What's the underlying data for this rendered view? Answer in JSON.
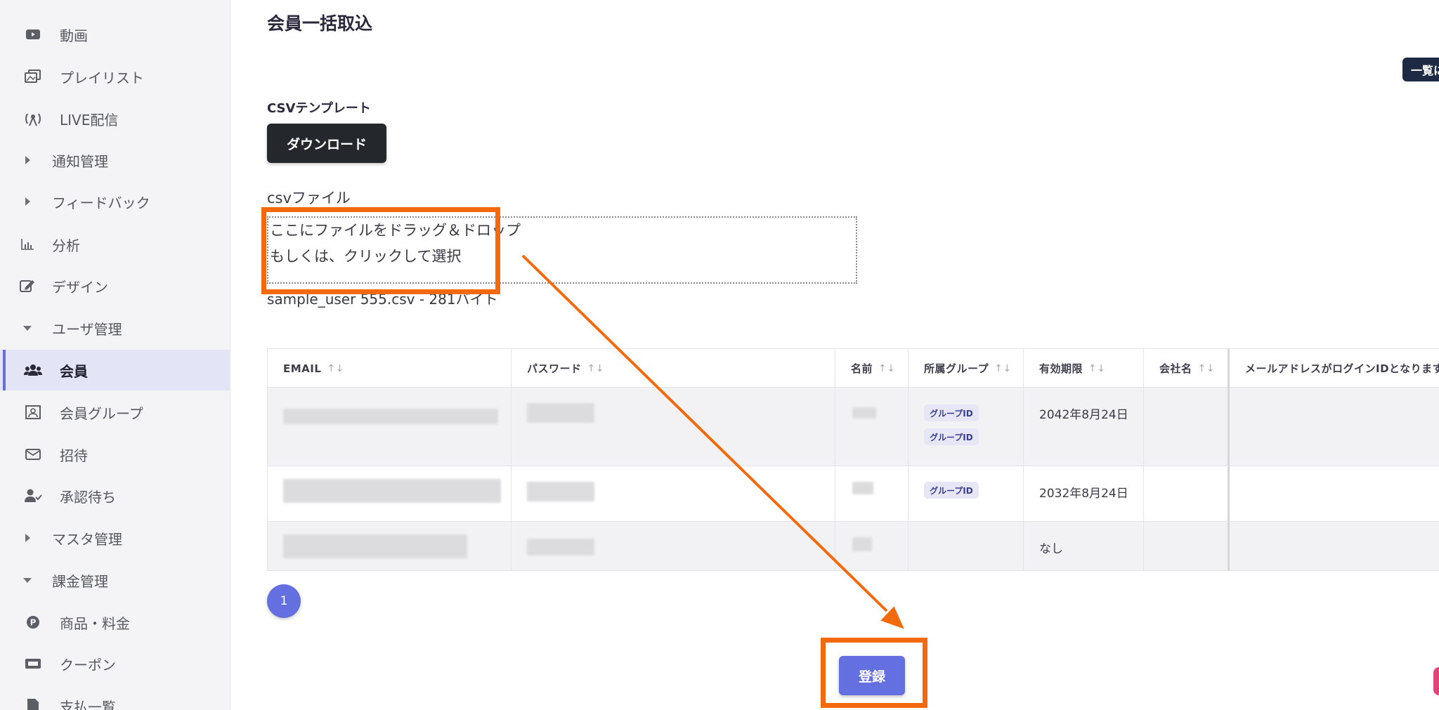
{
  "sidebar": {
    "items": [
      {
        "label": "動画",
        "icon": "video-icon"
      },
      {
        "label": "プレイリスト",
        "icon": "playlist-icon"
      },
      {
        "label": "LIVE配信",
        "icon": "live-broadcast-icon"
      },
      {
        "label": "通知管理",
        "icon": "expand-right-icon"
      },
      {
        "label": "フィードバック",
        "icon": "expand-right-icon"
      },
      {
        "label": "分析",
        "icon": "chart-icon"
      },
      {
        "label": "デザイン",
        "icon": "edit-icon"
      },
      {
        "label": "ユーザ管理",
        "icon": "collapse-down-icon"
      },
      {
        "label": "会員",
        "icon": "users-icon",
        "active": true
      },
      {
        "label": "会員グループ",
        "icon": "group-icon"
      },
      {
        "label": "招待",
        "icon": "mail-icon"
      },
      {
        "label": "承認待ち",
        "icon": "user-check-icon"
      },
      {
        "label": "マスタ管理",
        "icon": "expand-right-icon"
      },
      {
        "label": "課金管理",
        "icon": "collapse-down-icon"
      },
      {
        "label": "商品・料金",
        "icon": "p-coin-icon"
      },
      {
        "label": "クーポン",
        "icon": "ticket-icon"
      },
      {
        "label": "支払一覧",
        "icon": "document-icon"
      }
    ]
  },
  "main": {
    "title": "会員一括取込",
    "list_button": "一覧に",
    "csv_template_label": "CSVテンプレート",
    "download_button": "ダウンロード",
    "file_label": "csvファイル",
    "dropzone_line1": "ここにファイルをドラッグ＆ドロップ",
    "dropzone_line2": "もしくは、クリックして選択",
    "file_info": "sample_user 555.csv - 281バイト",
    "sort_glyph": "↑↓",
    "table": {
      "headers": [
        "EMAIL",
        "パスワード",
        "名前",
        "所属グループ",
        "有効期限",
        "会社名",
        "メールアドレスがログインIDとなります"
      ],
      "rows": [
        {
          "groups": [
            "グループID",
            "グループID"
          ],
          "expiry": "2042年8月24日"
        },
        {
          "groups": [
            "グループID"
          ],
          "expiry": "2032年8月24日"
        },
        {
          "groups": [],
          "expiry": "なし"
        }
      ]
    },
    "page_number": "1",
    "submit_button": "登録"
  },
  "colors": {
    "accent": "#6470e0",
    "annotation": "#f26a0c",
    "sidebar_bg": "#f4f4f7",
    "active_bg": "#e4e4f7"
  }
}
